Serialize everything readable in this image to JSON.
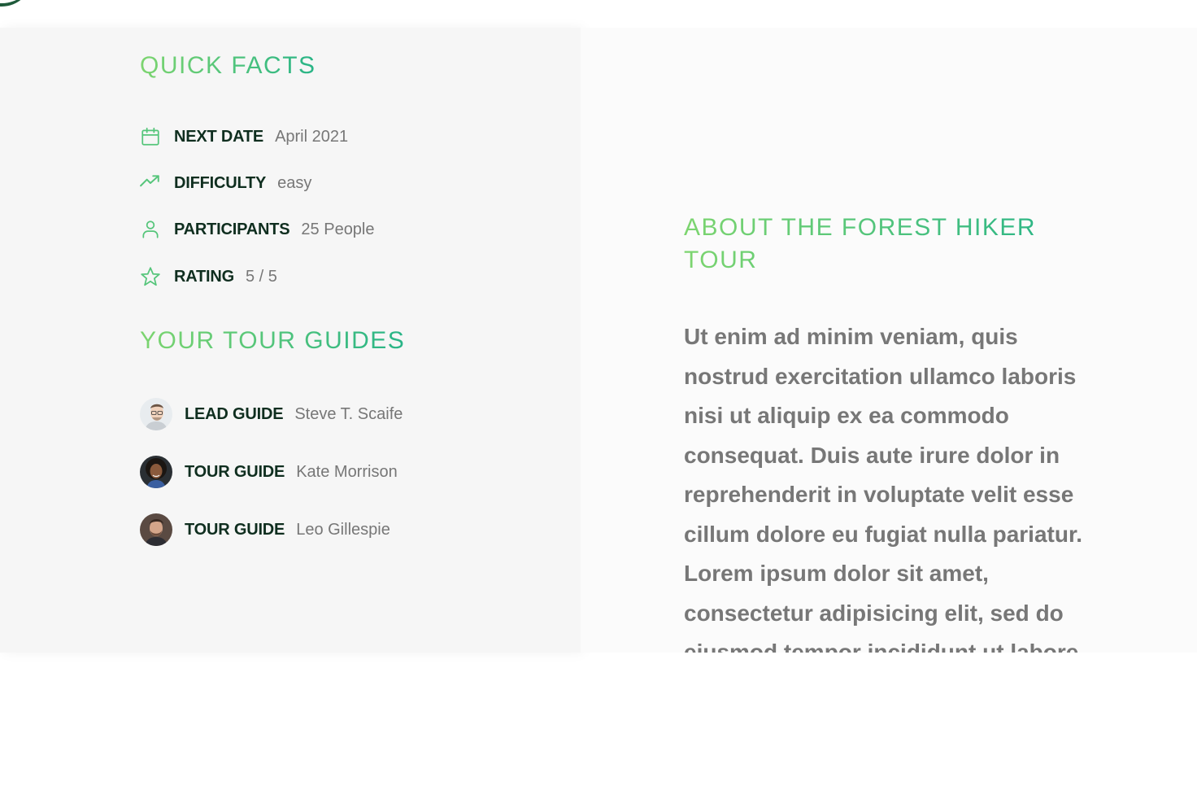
{
  "quick_facts": {
    "heading": "Quick facts",
    "items": [
      {
        "icon": "calendar-icon",
        "label": "Next date",
        "value": "April 2021"
      },
      {
        "icon": "trending-up-icon",
        "label": "Difficulty",
        "value": "easy"
      },
      {
        "icon": "user-icon",
        "label": "Participants",
        "value": "25 People"
      },
      {
        "icon": "star-icon",
        "label": "Rating",
        "value": "5 / 5"
      }
    ]
  },
  "tour_guides": {
    "heading": "Your tour guides",
    "items": [
      {
        "role": "Lead guide",
        "name": "Steve T. Scaife"
      },
      {
        "role": "Tour guide",
        "name": "Kate Morrison"
      },
      {
        "role": "Tour guide",
        "name": "Leo Gillespie"
      }
    ]
  },
  "about": {
    "heading": "About the Forest Hiker Tour",
    "paragraph": "Ut enim ad minim veniam, quis nostrud exercitation ullamco laboris nisi ut aliquip ex ea commodo consequat. Duis aute irure dolor in reprehenderit in voluptate velit esse cillum dolore eu fugiat nulla pariatur. Lorem ipsum dolor sit amet, consectetur adipisicing elit, sed do eiusmod tempor incididunt ut labore"
  },
  "colors": {
    "accent_start": "#7dd56f",
    "accent_end": "#28b487",
    "label": "#0f2e1f",
    "muted": "#777777"
  }
}
